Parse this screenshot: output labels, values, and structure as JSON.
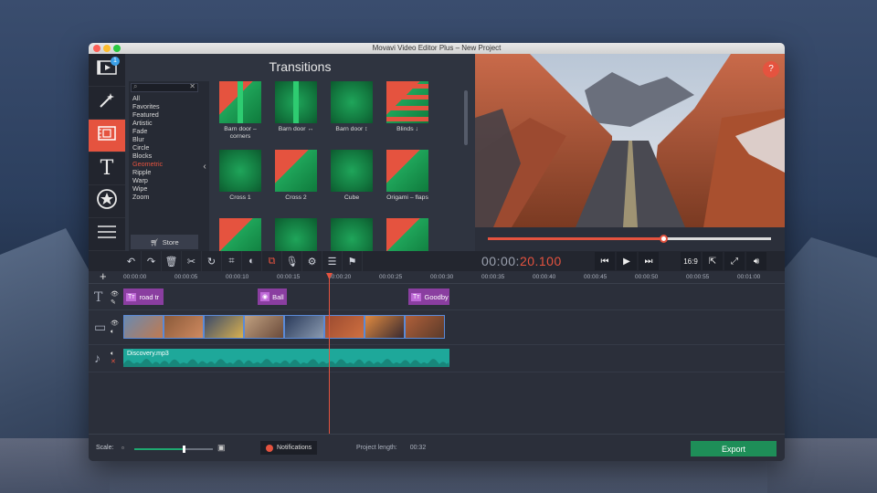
{
  "window": {
    "title": "Movavi Video Editor Plus – New Project"
  },
  "sidebar": {
    "items": [
      {
        "name": "import",
        "icon": "film-import-icon",
        "badge": "1"
      },
      {
        "name": "filters",
        "icon": "magic-wand-icon"
      },
      {
        "name": "transitions",
        "icon": "transitions-icon",
        "active": true
      },
      {
        "name": "titles",
        "icon": "text-T-icon"
      },
      {
        "name": "stickers",
        "icon": "star-icon"
      },
      {
        "name": "more",
        "icon": "menu-icon"
      }
    ]
  },
  "transitions": {
    "title": "Transitions",
    "search_placeholder": "",
    "categories": [
      "All",
      "Favorites",
      "Featured",
      "Artistic",
      "Fade",
      "Blur",
      "Circle",
      "Blocks",
      "Geometric",
      "Ripple",
      "Warp",
      "Wipe",
      "Zoom"
    ],
    "active_category": "Geometric",
    "store_label": "Store",
    "items": [
      {
        "label": "Barn door – corners"
      },
      {
        "label": "Barn door ↔"
      },
      {
        "label": "Barn door ↕"
      },
      {
        "label": "Blinds ↓"
      },
      {
        "label": "Cross 1"
      },
      {
        "label": "Cross 2"
      },
      {
        "label": "Cube"
      },
      {
        "label": "Origami – flaps"
      },
      {
        "label": ""
      },
      {
        "label": ""
      },
      {
        "label": ""
      },
      {
        "label": ""
      }
    ]
  },
  "preview": {
    "help_label": "?",
    "progress": 0.62
  },
  "timecode": {
    "prefix": "00:00:",
    "value": "20.100"
  },
  "playback": {
    "aspect_label": "16:9"
  },
  "ruler": {
    "ticks": [
      "00:00:00",
      "00:00:05",
      "00:00:10",
      "00:00:15",
      "00:00:20",
      "00:00:25",
      "00:00:30",
      "00:00:35",
      "00:00:40",
      "00:00:45",
      "00:00:50",
      "00:00:55",
      "00:01:00"
    ]
  },
  "tracks": {
    "titles": [
      {
        "label": "road tr"
      },
      {
        "label": "Ball"
      },
      {
        "label": "Goodby"
      }
    ],
    "audio": {
      "label": "Discovery.mp3"
    }
  },
  "bottom": {
    "scale_label": "Scale:",
    "scale_value": 0.62,
    "notifications_label": "Notifications",
    "project_length_label": "Project length:",
    "project_length_value": "00:32",
    "export_label": "Export"
  },
  "colors": {
    "accent": "#e5533f",
    "export": "#1e8e58",
    "audio": "#1ea89a",
    "title_clip": "#8a3ea0"
  }
}
